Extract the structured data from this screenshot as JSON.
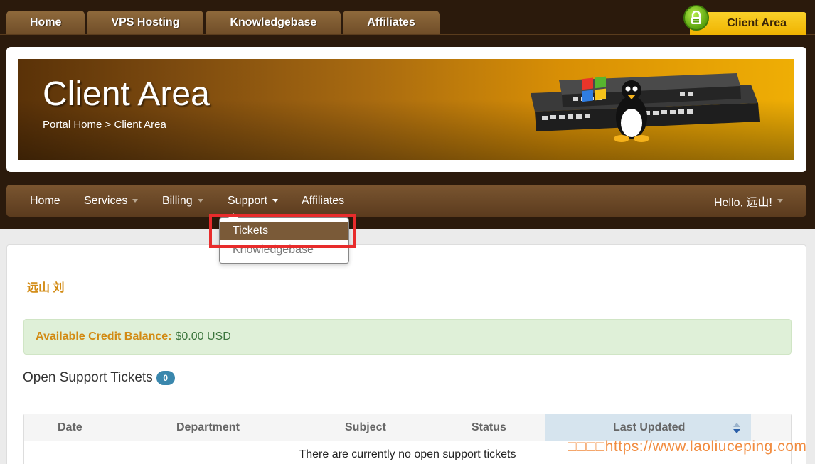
{
  "top_nav": {
    "tabs": [
      {
        "label": "Home"
      },
      {
        "label": "VPS Hosting"
      },
      {
        "label": "Knowledgebase"
      },
      {
        "label": "Affiliates"
      }
    ],
    "client_area_label": "Client Area",
    "lock_icon": "lock-icon"
  },
  "hero": {
    "title": "Client Area",
    "breadcrumb": {
      "home": "Portal Home",
      "separator": ">",
      "current": "Client Area"
    }
  },
  "main_nav": {
    "items": [
      {
        "label": "Home",
        "has_caret": false
      },
      {
        "label": "Services",
        "has_caret": true
      },
      {
        "label": "Billing",
        "has_caret": true
      },
      {
        "label": "Support",
        "has_caret": true,
        "open": true
      },
      {
        "label": "Affiliates",
        "has_caret": false
      }
    ],
    "greeting": "Hello, 远山!"
  },
  "support_dropdown": {
    "items": [
      {
        "label": "Tickets",
        "active": true
      },
      {
        "label": "Knowledgebase",
        "active": false
      }
    ],
    "highlight_color": "#e82c2c"
  },
  "content": {
    "user_name": "远山 刘",
    "credit": {
      "label": "Available Credit Balance:",
      "value": "$0.00 USD"
    },
    "tickets": {
      "heading": "Open Support Tickets",
      "count": "0",
      "columns": [
        "Date",
        "Department",
        "Subject",
        "Status",
        "Last Updated"
      ],
      "sorted_column": "Last Updated",
      "empty_message": "There are currently no open support tickets"
    }
  },
  "watermark": "□□□□https://www.laoliuceping.com",
  "colors": {
    "accent_orange": "#d28a12",
    "nav_brown": "#6a4827",
    "credit_bg": "#dff0d8",
    "badge_blue": "#3a87ad"
  }
}
